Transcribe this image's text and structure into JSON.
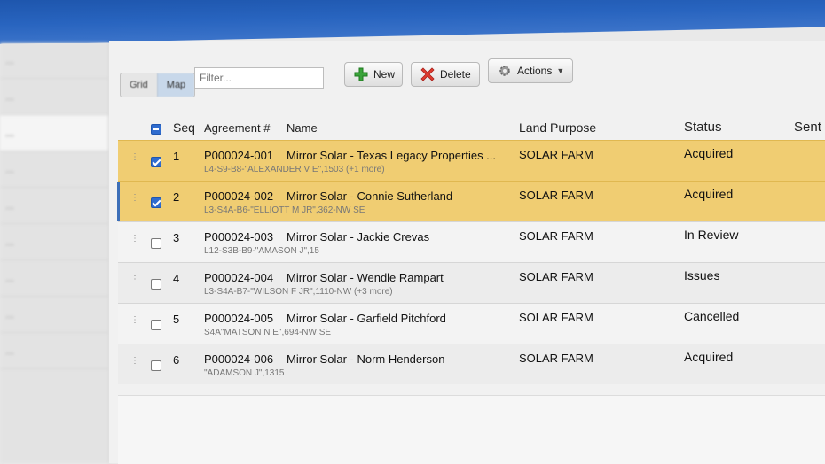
{
  "app": {
    "title": ""
  },
  "sidebar": {
    "items": [
      {
        "label": "..."
      },
      {
        "label": "..."
      },
      {
        "label": "..."
      },
      {
        "label": "..."
      },
      {
        "label": "..."
      },
      {
        "label": "..."
      },
      {
        "label": "..."
      },
      {
        "label": "..."
      },
      {
        "label": "..."
      }
    ]
  },
  "toolbar": {
    "view_grid": "Grid",
    "view_map": "Map",
    "filter_placeholder": "Filter...",
    "new_label": "New",
    "delete_label": "Delete",
    "actions_label": "Actions"
  },
  "table": {
    "headers": {
      "seq": "Seq",
      "agreement": "Agreement #",
      "name": "Name",
      "land_purpose": "Land Purpose",
      "status": "Status",
      "sent": "Sent"
    },
    "rows": [
      {
        "seq": "1",
        "agreement": "P000024-001",
        "name": "Mirror Solar - Texas Legacy Properties ...",
        "sub": "L4-S9-B8-\"ALEXANDER V E\",1503 (+1 more)",
        "purpose": "SOLAR FARM",
        "status": "Acquired",
        "checked": true
      },
      {
        "seq": "2",
        "agreement": "P000024-002",
        "name": "Mirror Solar - Connie Sutherland",
        "sub": "L3-S4A-B6-\"ELLIOTT M JR\",362-NW SE",
        "purpose": "SOLAR FARM",
        "status": "Acquired",
        "checked": true
      },
      {
        "seq": "3",
        "agreement": "P000024-003",
        "name": "Mirror Solar - Jackie Crevas",
        "sub": "L12-S3B-B9-\"AMASON J\",15",
        "purpose": "SOLAR FARM",
        "status": "In Review",
        "checked": false
      },
      {
        "seq": "4",
        "agreement": "P000024-004",
        "name": "Mirror Solar - Wendle Rampart",
        "sub": "L3-S4A-B7-\"WILSON F JR\",1110-NW (+3 more)",
        "purpose": "SOLAR FARM",
        "status": "Issues",
        "checked": false
      },
      {
        "seq": "5",
        "agreement": "P000024-005",
        "name": "Mirror Solar - Garfield Pitchford",
        "sub": "S4A\"MATSON N E\",694-NW SE",
        "purpose": "SOLAR FARM",
        "status": "Cancelled",
        "checked": false
      },
      {
        "seq": "6",
        "agreement": "P000024-006",
        "name": "Mirror Solar - Norm Henderson",
        "sub": "\"ADAMSON J\",1315",
        "purpose": "SOLAR FARM",
        "status": "Acquired",
        "checked": false
      }
    ]
  },
  "colors": {
    "header_blue": "#2864bf",
    "selected_row": "#f0cd72",
    "checkbox_blue": "#2f6ccf"
  }
}
